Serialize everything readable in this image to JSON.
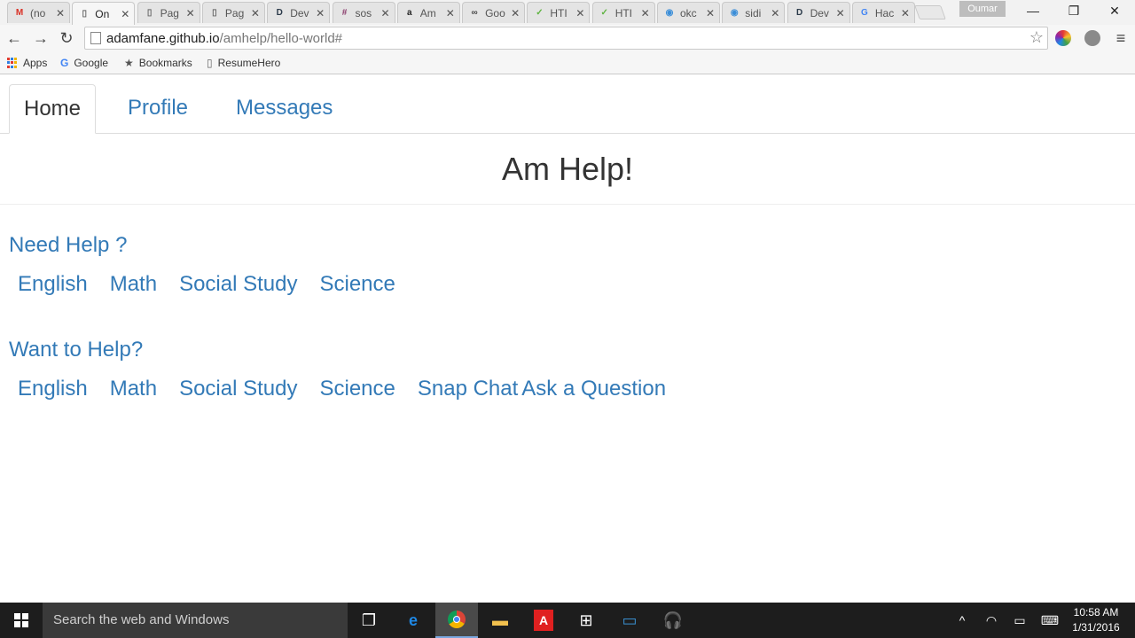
{
  "browser": {
    "tabs": [
      {
        "title": "(no",
        "favicon": "gmail-icon",
        "color": "#d93025",
        "glyph": "M",
        "active": false
      },
      {
        "title": "On",
        "favicon": "page-icon",
        "color": "#666666",
        "glyph": "▯",
        "active": true
      },
      {
        "title": "Pag",
        "favicon": "page-icon",
        "color": "#666666",
        "glyph": "▯",
        "active": false
      },
      {
        "title": "Pag",
        "favicon": "page-icon",
        "color": "#666666",
        "glyph": "▯",
        "active": false
      },
      {
        "title": "Dev",
        "favicon": "d-icon",
        "color": "#2b3a4a",
        "glyph": "D",
        "active": false
      },
      {
        "title": "sos",
        "favicon": "slack-icon",
        "color": "#8a3b6b",
        "glyph": "#",
        "active": false
      },
      {
        "title": "Am",
        "favicon": "amazon-icon",
        "color": "#222222",
        "glyph": "a",
        "active": false
      },
      {
        "title": "Goo",
        "favicon": "people-icon",
        "color": "#444444",
        "glyph": "∞",
        "active": false
      },
      {
        "title": "HTI",
        "favicon": "html-icon",
        "color": "#5fb441",
        "glyph": "✓",
        "active": false
      },
      {
        "title": "HTI",
        "favicon": "html-icon",
        "color": "#5fb441",
        "glyph": "✓",
        "active": false
      },
      {
        "title": "okc",
        "favicon": "okc-icon",
        "color": "#3b8ed8",
        "glyph": "◉",
        "active": false
      },
      {
        "title": "sidi",
        "favicon": "okc-icon",
        "color": "#3b8ed8",
        "glyph": "◉",
        "active": false
      },
      {
        "title": "Dev",
        "favicon": "d-icon",
        "color": "#2b3a4a",
        "glyph": "D",
        "active": false
      },
      {
        "title": "Hac",
        "favicon": "google-icon",
        "color": "#4285f4",
        "glyph": "G",
        "active": false
      }
    ],
    "profile_name": "Oumar",
    "address": {
      "host": "adamfane.github.io",
      "path": "/amhelp/hello-world#"
    },
    "bookmarks": [
      {
        "label": "Apps",
        "icon": "apps-grid-icon"
      },
      {
        "label": "Google",
        "icon": "google-icon"
      },
      {
        "label": "Bookmarks",
        "icon": "star-icon"
      },
      {
        "label": "ResumeHero",
        "icon": "page-icon"
      }
    ]
  },
  "page": {
    "nav_tabs": [
      {
        "label": "Home",
        "active": true
      },
      {
        "label": "Profile",
        "active": false
      },
      {
        "label": "Messages",
        "active": false
      }
    ],
    "title": "Am Help!",
    "need_help": {
      "heading": "Need Help ?",
      "links": [
        "English",
        "Math",
        "Social Study",
        "Science"
      ]
    },
    "want_help": {
      "heading": "Want to Help?",
      "links": [
        "English",
        "Math",
        "Social Study",
        "Science",
        "Snap Chat",
        "Ask a Question"
      ]
    },
    "colors": {
      "link": "#337ab7",
      "text": "#333333"
    }
  },
  "taskbar": {
    "search_placeholder": "Search the web and Windows",
    "time": "10:58 AM",
    "date": "1/31/2016"
  }
}
